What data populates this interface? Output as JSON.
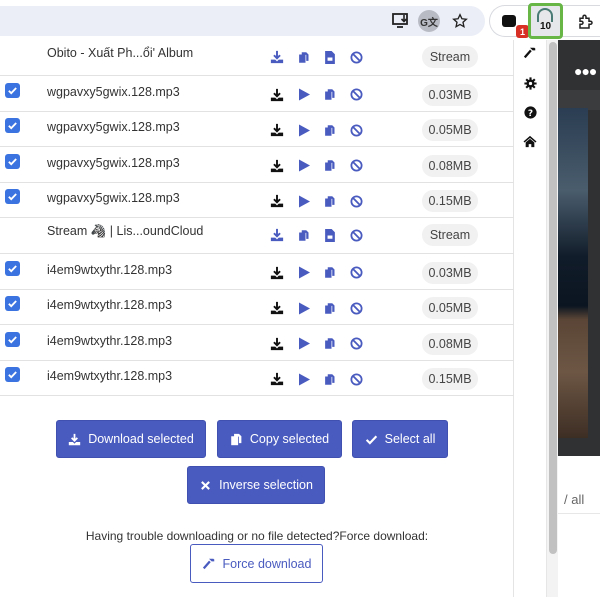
{
  "toolbar": {
    "icons": [
      "install-app-icon",
      "translate-icon",
      "bookmark-star-icon"
    ],
    "translate_glyph": "G文",
    "extensions": {
      "first_badge": "1",
      "active_badge": "10"
    }
  },
  "rows": [
    {
      "type": "page",
      "checked": false,
      "name": "Obito - Xuất Ph...ổi' Album",
      "size": "Stream"
    },
    {
      "type": "file",
      "checked": true,
      "name": "wgpavxy5gwix.128.mp3",
      "size": "0.03MB"
    },
    {
      "type": "file",
      "checked": true,
      "name": "wgpavxy5gwix.128.mp3",
      "size": "0.05MB"
    },
    {
      "type": "file",
      "checked": true,
      "name": "wgpavxy5gwix.128.mp3",
      "size": "0.08MB"
    },
    {
      "type": "file",
      "checked": true,
      "name": "wgpavxy5gwix.128.mp3",
      "size": "0.15MB"
    },
    {
      "type": "page",
      "checked": false,
      "name": "Stream 🦓 | Lis...oundCloud",
      "size": "Stream"
    },
    {
      "type": "file",
      "checked": true,
      "name": "i4em9wtxythr.128.mp3",
      "size": "0.03MB"
    },
    {
      "type": "file",
      "checked": true,
      "name": "i4em9wtxythr.128.mp3",
      "size": "0.05MB"
    },
    {
      "type": "file",
      "checked": true,
      "name": "i4em9wtxythr.128.mp3",
      "size": "0.08MB"
    },
    {
      "type": "file",
      "checked": true,
      "name": "i4em9wtxythr.128.mp3",
      "size": "0.15MB"
    }
  ],
  "actions": {
    "download_selected": "Download selected",
    "copy_selected": "Copy selected",
    "select_all": "Select all",
    "inverse_selection": "Inverse selection"
  },
  "help_text": "Having trouble downloading or no file detected?Force download:",
  "force_download": "Force download",
  "side_menu": [
    "hammer-icon",
    "gear-icon",
    "help-icon",
    "home-icon"
  ],
  "background_page": {
    "view_all_fragment": "/ all"
  },
  "colors": {
    "accent": "#4a5bbf",
    "checkbox": "#3b73e0",
    "active_extension_border": "#67b646",
    "badge_red": "#d93025"
  }
}
